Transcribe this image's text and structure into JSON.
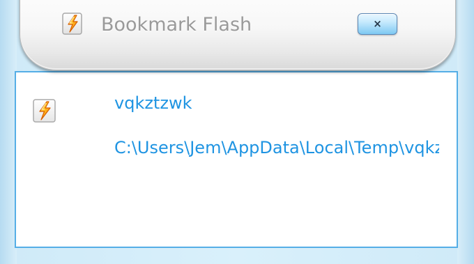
{
  "dialog": {
    "title": "Bookmark Flash",
    "close_label": "×",
    "icon": "flash-bookmark-icon"
  },
  "bookmark": {
    "icon": "flash-file-icon",
    "name": "vqkztzwk",
    "path": "C:\\Users\\Jem\\AppData\\Local\\Temp\\vqkz"
  },
  "colors": {
    "frame": "#c9e4f5",
    "panel_border": "#55aee6",
    "link_text": "#1f94e2",
    "title_text": "#9a9a9a",
    "button_blue": "#7ec8f2"
  }
}
